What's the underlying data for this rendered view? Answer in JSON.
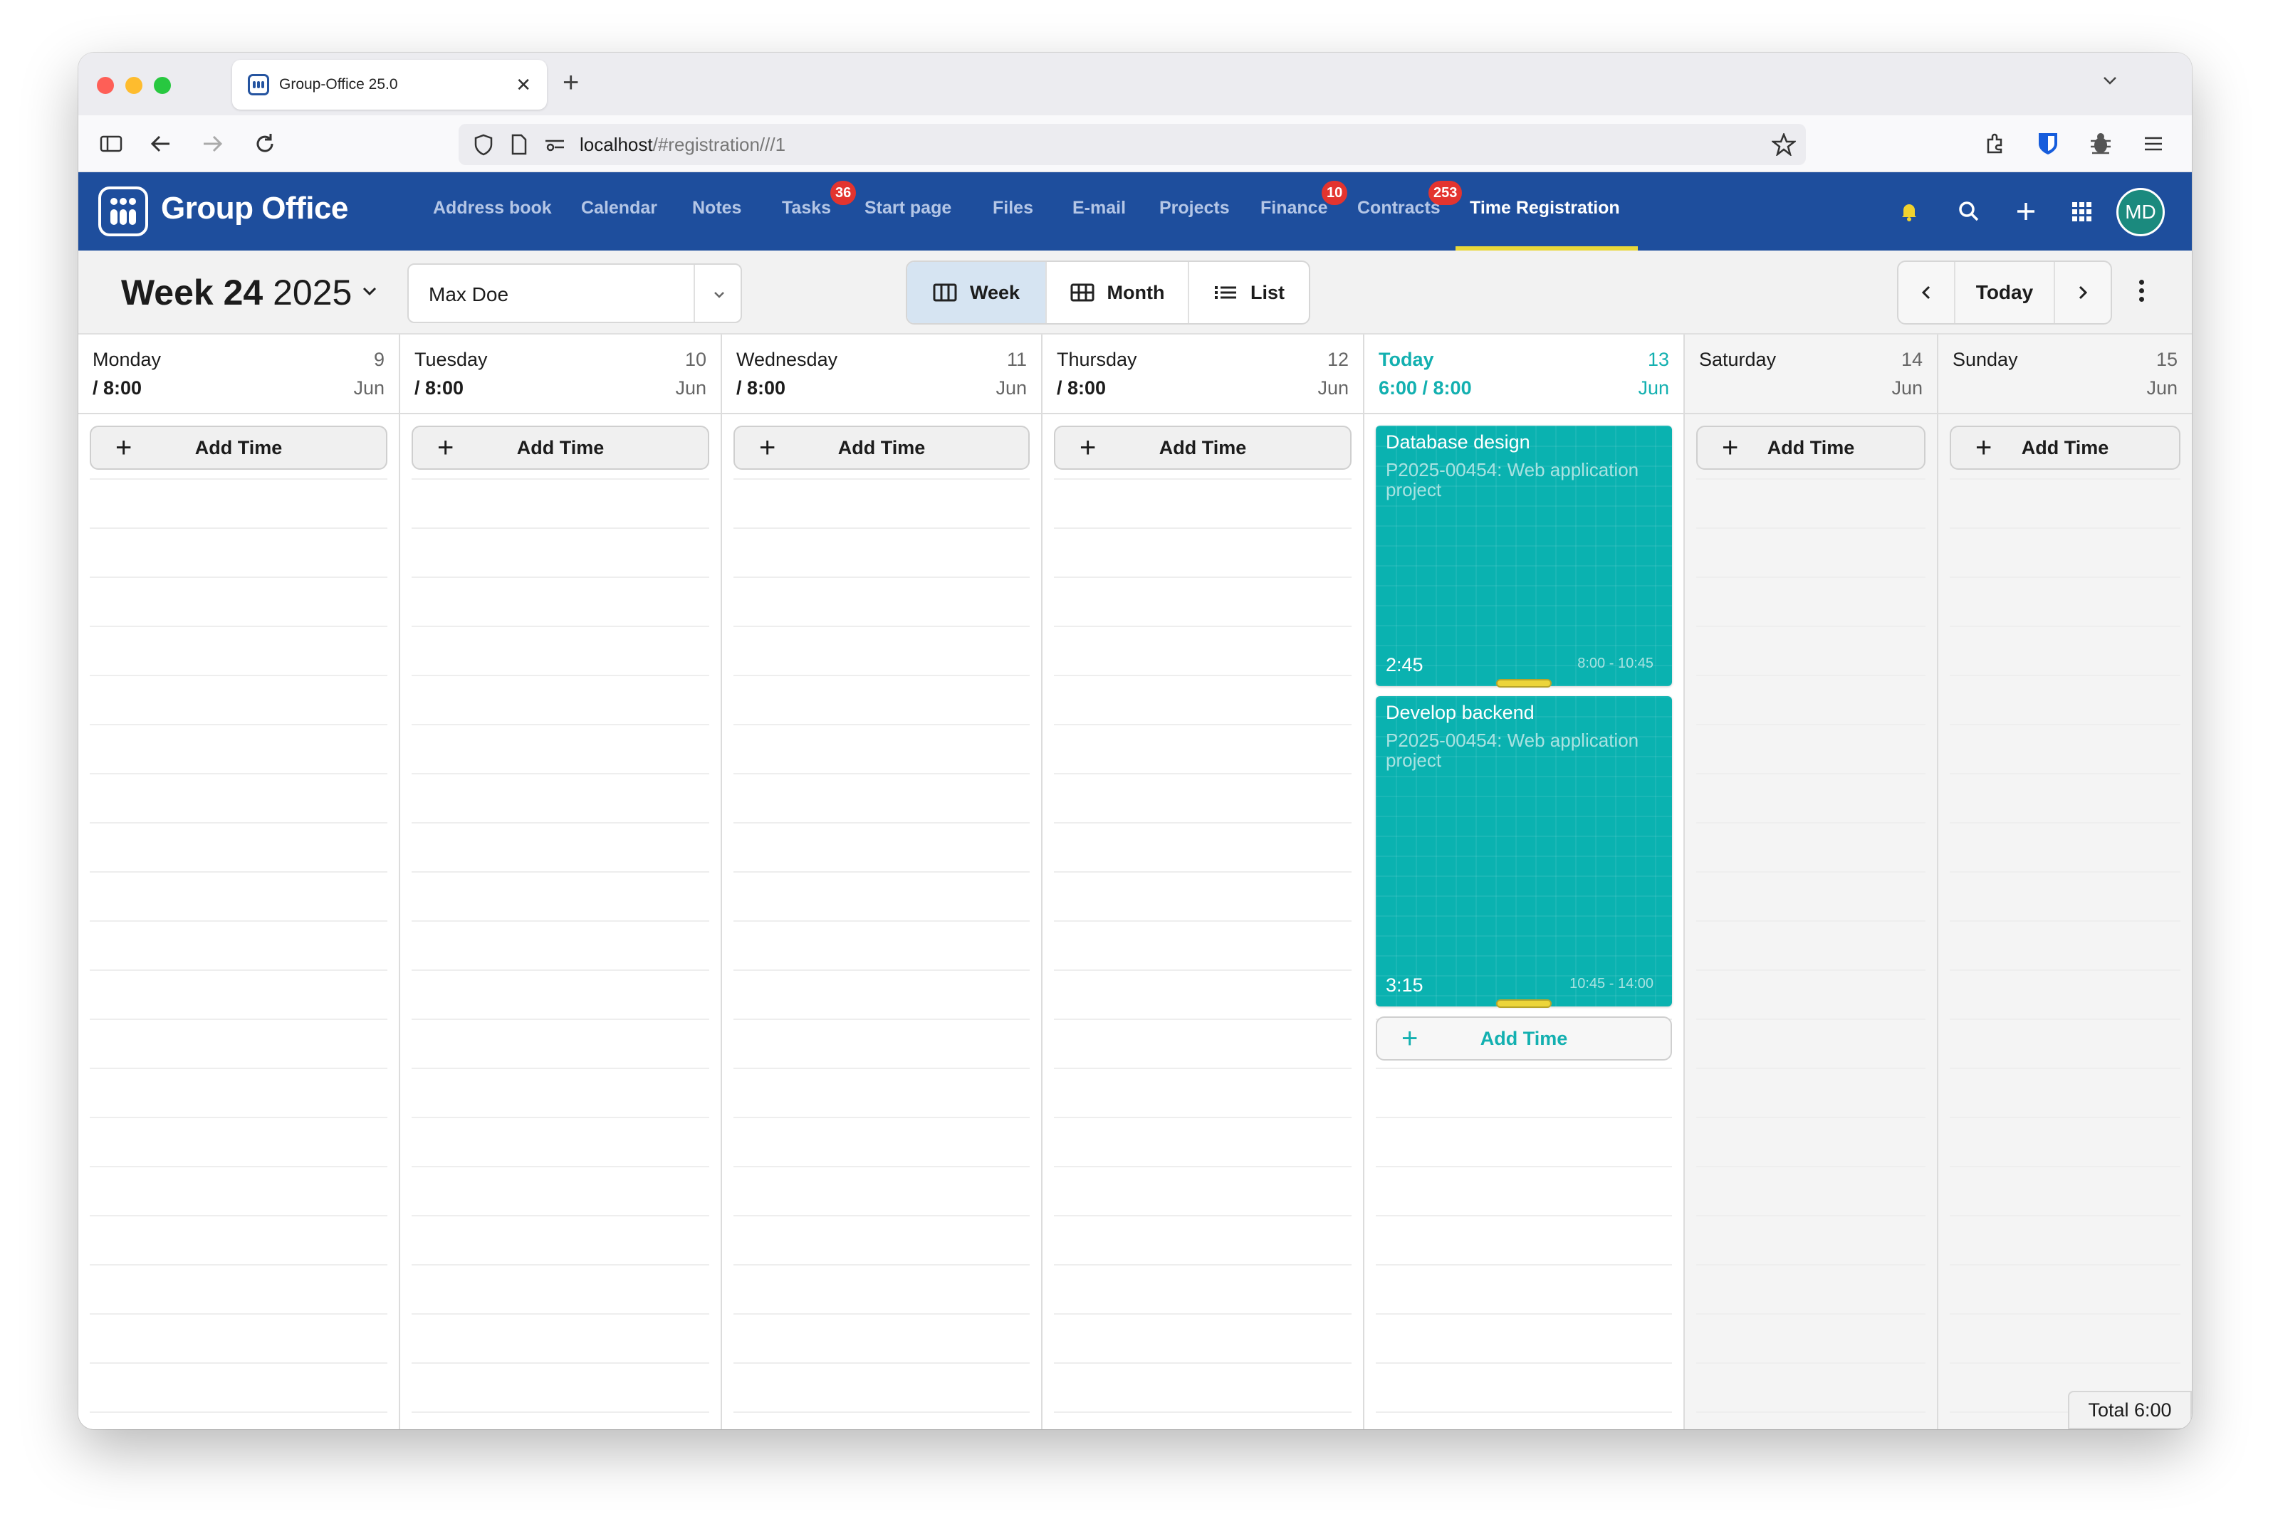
{
  "browser": {
    "tab_title": "Group-Office 25.0",
    "url_host": "localhost",
    "url_path": "/#registration///1"
  },
  "app": {
    "name": "Group Office",
    "avatar_initials": "MD",
    "brand_color": "#1e4e9d",
    "menu": [
      {
        "label": "Address book"
      },
      {
        "label": "Calendar"
      },
      {
        "label": "Notes"
      },
      {
        "label": "Tasks",
        "badge": "36"
      },
      {
        "label": "Start page"
      },
      {
        "label": "Files"
      },
      {
        "label": "E-mail"
      },
      {
        "label": "Projects"
      },
      {
        "label": "Finance",
        "badge": "10"
      },
      {
        "label": "Contracts",
        "badge": "253"
      },
      {
        "label": "Time Registration",
        "active": true
      }
    ]
  },
  "toolbar": {
    "week_label": "Week 24",
    "year": "2025",
    "user": "Max Doe",
    "views": [
      "Week",
      "Month",
      "List"
    ],
    "active_view": "Week",
    "today_label": "Today"
  },
  "days": [
    {
      "name": "Monday",
      "num": "9",
      "month": "Jun",
      "total": "/ 8:00"
    },
    {
      "name": "Tuesday",
      "num": "10",
      "month": "Jun",
      "total": "/ 8:00"
    },
    {
      "name": "Wednesday",
      "num": "11",
      "month": "Jun",
      "total": "/ 8:00"
    },
    {
      "name": "Thursday",
      "num": "12",
      "month": "Jun",
      "total": "/ 8:00"
    },
    {
      "name": "Today",
      "num": "13",
      "month": "Jun",
      "total": "6:00 / 8:00"
    },
    {
      "name": "Saturday",
      "num": "14",
      "month": "Jun",
      "total": ""
    },
    {
      "name": "Sunday",
      "num": "15",
      "month": "Jun",
      "total": ""
    }
  ],
  "add_time_label": "Add Time",
  "entries": [
    {
      "title": "Database design",
      "project": "P2025-00454: Web application project",
      "duration": "2:45",
      "range": "8:00 - 10:45"
    },
    {
      "title": "Develop backend",
      "project": "P2025-00454: Web application project",
      "duration": "3:15",
      "range": "10:45 - 14:00"
    }
  ],
  "total_label": "Total 6:00",
  "colors": {
    "accent_teal": "#0ab2b0",
    "today_text": "#13b0b0",
    "badge_red": "#e3342f",
    "active_underline": "#e9d83a"
  }
}
